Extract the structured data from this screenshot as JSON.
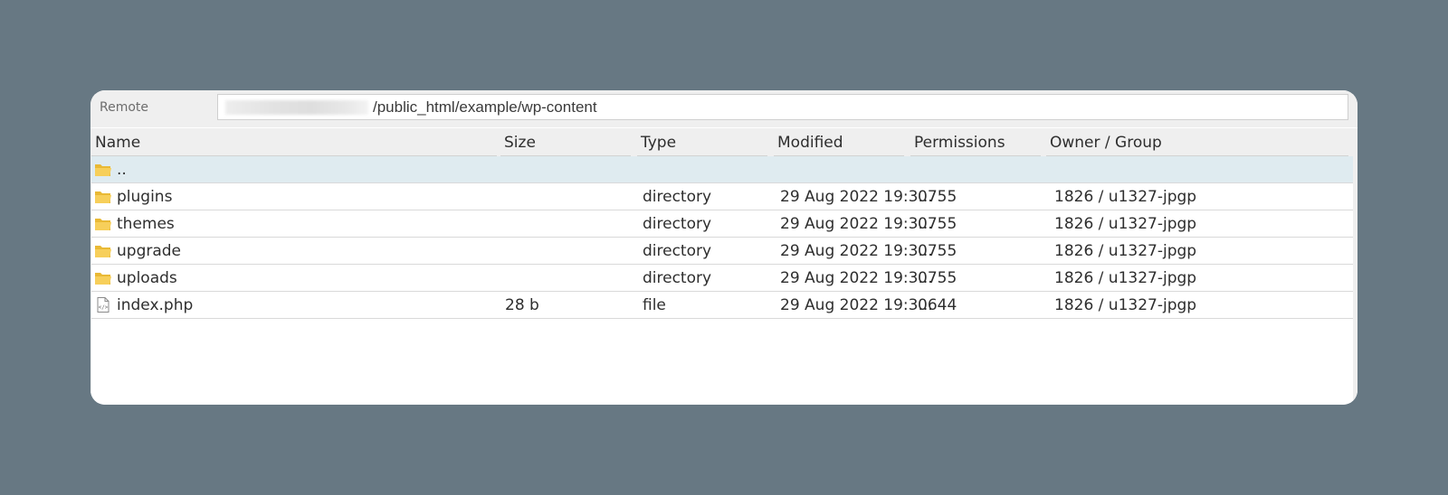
{
  "remote": {
    "label": "Remote",
    "path_suffix": "/public_html/example/wp-content"
  },
  "columns": [
    "Name",
    "Size",
    "Type",
    "Modified",
    "Permissions",
    "Owner / Group"
  ],
  "rows": [
    {
      "name": "..",
      "size": "",
      "type": "",
      "modified": "",
      "permissions": "",
      "owner": "",
      "icon": "folder-icon",
      "selected": true
    },
    {
      "name": "plugins",
      "size": "",
      "type": "directory",
      "modified": "29 Aug 2022 19:3...",
      "permissions": "0755",
      "owner": "1826 / u1327-jpgp",
      "icon": "folder-icon"
    },
    {
      "name": "themes",
      "size": "",
      "type": "directory",
      "modified": "29 Aug 2022 19:3...",
      "permissions": "0755",
      "owner": "1826 / u1327-jpgp",
      "icon": "folder-icon"
    },
    {
      "name": "upgrade",
      "size": "",
      "type": "directory",
      "modified": "29 Aug 2022 19:3...",
      "permissions": "0755",
      "owner": "1826 / u1327-jpgp",
      "icon": "folder-icon"
    },
    {
      "name": "uploads",
      "size": "",
      "type": "directory",
      "modified": "29 Aug 2022 19:3...",
      "permissions": "0755",
      "owner": "1826 / u1327-jpgp",
      "icon": "folder-icon"
    },
    {
      "name": "index.php",
      "size": "28 b",
      "type": "file",
      "modified": "29 Aug 2022 19:3...",
      "permissions": "0644",
      "owner": "1826 / u1327-jpgp",
      "icon": "php-file-icon"
    }
  ],
  "colors": {
    "background": "#677883",
    "selected_row": "#dfebf0",
    "folder": "#f5c64f"
  }
}
